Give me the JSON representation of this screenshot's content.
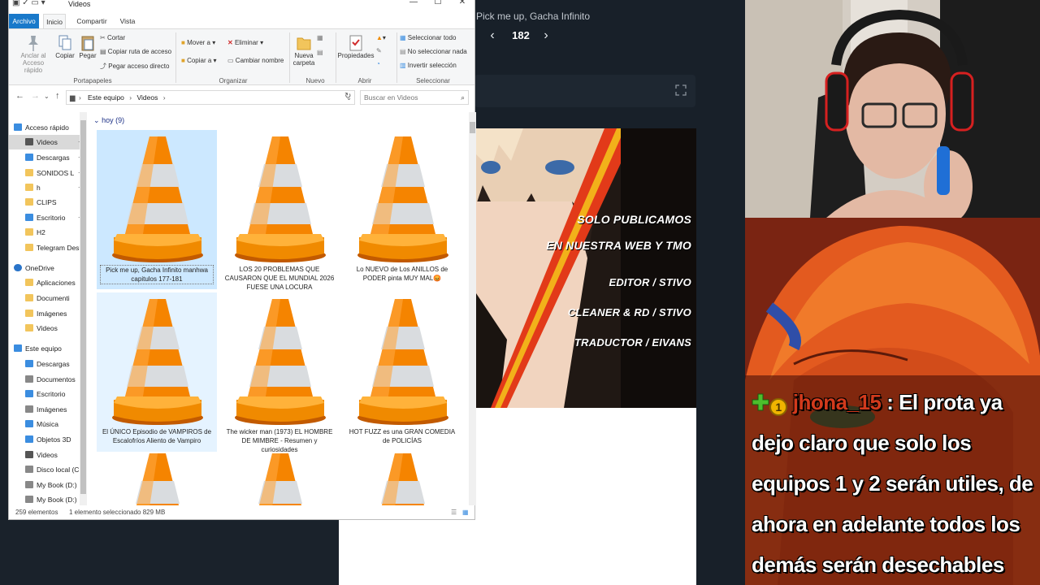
{
  "reader": {
    "manga_title": "Pick me up, Gacha Infinito",
    "chapter": "182",
    "prev_icon": "chevron-left",
    "next_icon": "chevron-right",
    "credits": [
      "SOLO PUBLICAMOS",
      "EN NUESTRA WEB Y TMO",
      "EDITOR / STIVO",
      "CLEANER & RD / STIVO",
      "TRADUCTOR / EIVANS"
    ]
  },
  "explorer": {
    "window_title": "Videos",
    "tabs": {
      "file": "Archivo",
      "home": "Inicio",
      "share": "Compartir",
      "view": "Vista"
    },
    "ribbon": {
      "pin": "Anclar al\nAcceso rápido",
      "copy": "Copiar",
      "paste": "Pegar",
      "cut": "Cortar",
      "copy_path": "Copiar ruta de acceso",
      "paste_shortcut": "Pegar acceso directo",
      "group_clipboard": "Portapapeles",
      "move_to": "Mover a",
      "copy_to": "Copiar a",
      "delete": "Eliminar",
      "rename": "Cambiar nombre",
      "group_organize": "Organizar",
      "new_folder": "Nueva\ncarpeta",
      "group_new": "Nuevo",
      "properties": "Propiedades",
      "group_open": "Abrir",
      "select_all": "Seleccionar todo",
      "select_none": "No seleccionar nada",
      "invert_selection": "Invertir selección",
      "group_select": "Seleccionar"
    },
    "address": {
      "path_root": "Este equipo",
      "path_folder": "Videos",
      "search_placeholder": "Buscar en Videos"
    },
    "nav": [
      {
        "label": "Acceso rápido",
        "icon": "star-icon",
        "color": "#3b8de0"
      },
      {
        "label": "Videos",
        "icon": "videos-icon",
        "color": "#555555",
        "pinned": true,
        "selected": true
      },
      {
        "label": "Descargas",
        "icon": "download-icon",
        "color": "#3b8de0",
        "pinned": true
      },
      {
        "label": "SONIDOS L",
        "icon": "folder-icon",
        "color": "#f2c55c",
        "pinned": true
      },
      {
        "label": "h",
        "icon": "folder-icon",
        "color": "#f2c55c",
        "pinned": true
      },
      {
        "label": "CLIPS",
        "icon": "folder-icon",
        "color": "#f2c55c"
      },
      {
        "label": "Escritorio",
        "icon": "desktop-icon",
        "color": "#3b8de0",
        "pinned": true
      },
      {
        "label": "H2",
        "icon": "folder-icon",
        "color": "#f2c55c"
      },
      {
        "label": "Telegram Desk",
        "icon": "folder-icon",
        "color": "#f2c55c"
      },
      {
        "label": "OneDrive",
        "icon": "cloud-icon",
        "color": "#2a74c9"
      },
      {
        "label": "Aplicaciones",
        "icon": "folder-icon",
        "color": "#f2c55c"
      },
      {
        "label": "Documenti",
        "icon": "folder-icon",
        "color": "#f2c55c"
      },
      {
        "label": "Imágenes",
        "icon": "folder-icon",
        "color": "#f2c55c"
      },
      {
        "label": "Videos",
        "icon": "folder-icon",
        "color": "#f2c55c"
      },
      {
        "label": "Este equipo",
        "icon": "computer-icon",
        "color": "#3b8de0"
      },
      {
        "label": "Descargas",
        "icon": "download-icon",
        "color": "#3b8de0"
      },
      {
        "label": "Documentos",
        "icon": "documents-icon",
        "color": "#888888"
      },
      {
        "label": "Escritorio",
        "icon": "desktop-icon",
        "color": "#3b8de0"
      },
      {
        "label": "Imágenes",
        "icon": "images-icon",
        "color": "#888888"
      },
      {
        "label": "Música",
        "icon": "music-icon",
        "color": "#3b8de0"
      },
      {
        "label": "Objetos 3D",
        "icon": "cube-icon",
        "color": "#3b8de0"
      },
      {
        "label": "Videos",
        "icon": "videos-icon",
        "color": "#555555"
      },
      {
        "label": "Disco local (C:",
        "icon": "drive-icon",
        "color": "#888888"
      },
      {
        "label": "My Book (D:)",
        "icon": "drive-icon",
        "color": "#888888"
      },
      {
        "label": "My Book (D:)",
        "icon": "drive-icon",
        "color": "#888888"
      }
    ],
    "group_header": "hoy (9)",
    "files": [
      {
        "name": "Pick me up, Gacha Infinito manhwa capitulos  177-181",
        "state": "selected"
      },
      {
        "name": "LOS 20 PROBLEMAS QUE CAUSARON QUE EL MUNDIAL 2026 FUESE UNA LOCURA",
        "state": ""
      },
      {
        "name": "Lo NUEVO de Los ANILLOS de PODER pinta MUY MAL😡",
        "state": ""
      },
      {
        "name": "El ÚNICO Episodio de VAMPIROS de Escalofríos  Aliento de Vampiro",
        "state": "hover"
      },
      {
        "name": "The wicker man (1973) EL HOMBRE DE MIMBRE - Resumen y curiosidades",
        "state": ""
      },
      {
        "name": "HOT FUZZ es una GRAN COMEDIA de POLICÍAS",
        "state": ""
      },
      {
        "name": "",
        "state": ""
      },
      {
        "name": "",
        "state": ""
      },
      {
        "name": "",
        "state": ""
      }
    ],
    "status": {
      "count": "259 elementos",
      "selection": "1 elemento seleccionado  829 MB"
    }
  },
  "chat": {
    "username": "jhona_15",
    "separator": ":",
    "message": "El prota ya dejo claro que solo los equipos 1 y 2 serán utiles, de ahora en adelante todos los demás serán desechables",
    "badge_coin_label": "1",
    "colors": {
      "username": "#d23a1c",
      "text": "#ffffff"
    }
  }
}
